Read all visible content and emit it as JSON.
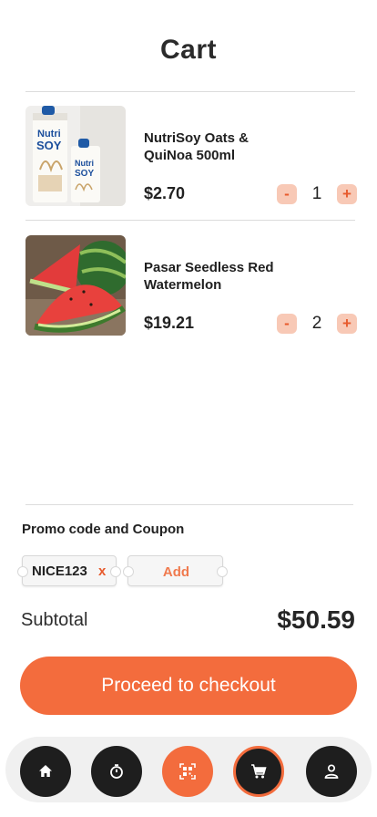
{
  "header": {
    "title": "Cart"
  },
  "cart": {
    "items": [
      {
        "name": "NutriSoy Oats & QuiNoa 500ml",
        "price": "$2.70",
        "quantity": "1",
        "minus": "-",
        "plus": "+"
      },
      {
        "name": "Pasar Seedless Red Watermelon",
        "price": "$19.21",
        "quantity": "2",
        "minus": "-",
        "plus": "+"
      }
    ]
  },
  "product_art": {
    "brand_line1": "Nutri",
    "brand_line2": "SOY"
  },
  "promo": {
    "label": "Promo code and Coupon",
    "applied_code": "NICE123",
    "remove_label": "x",
    "add_label": "Add"
  },
  "summary": {
    "subtotal_label": "Subtotal",
    "subtotal_value": "$50.59"
  },
  "checkout": {
    "label": "Proceed to checkout"
  },
  "nav": {
    "items": [
      {
        "icon": "home-icon"
      },
      {
        "icon": "timer-icon"
      },
      {
        "icon": "qr-scan-icon"
      },
      {
        "icon": "cart-icon",
        "active": true
      },
      {
        "icon": "profile-icon"
      }
    ]
  },
  "colors": {
    "accent": "#f36c3d",
    "accent_light": "#f8c9b6",
    "nav_dark": "#1e1e1e",
    "nav_bar": "#f0f0f0"
  }
}
